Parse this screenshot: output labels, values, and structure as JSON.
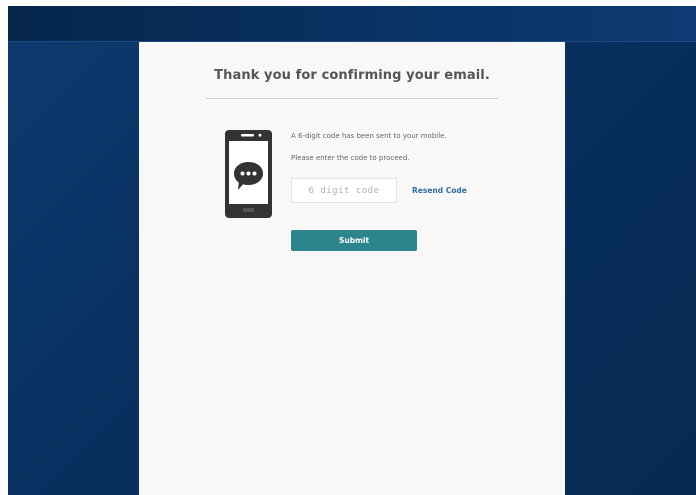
{
  "page": {
    "title": "Thank you for confirming your email."
  },
  "verification": {
    "icon": "mobile-phone-chat-icon",
    "message_sent": "A 6-digit code has been sent to your mobile.",
    "instruction": "Please enter the code to proceed.",
    "code_input": {
      "value": "",
      "placeholder": "6 digit code"
    },
    "resend_label": "Resend Code",
    "submit_label": "Submit"
  },
  "colors": {
    "background": "#08305f",
    "panel": "#f8f8f8",
    "accent": "#2c858d",
    "link": "#2f6ea3"
  }
}
